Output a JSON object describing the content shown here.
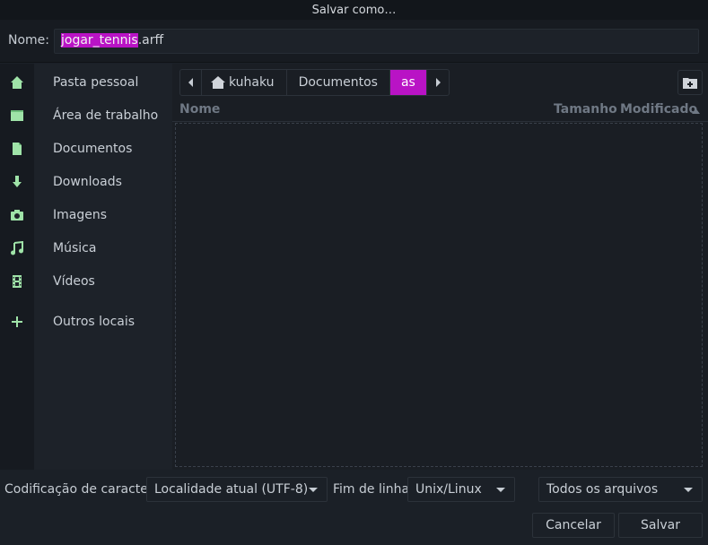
{
  "window": {
    "title": "Salvar como…"
  },
  "name_row": {
    "label": "Nome:",
    "value_selected": "jogar_tennis",
    "value_rest": ".arff"
  },
  "sidebar": {
    "items": [
      {
        "label": "Pasta pessoal",
        "icon": "home-icon"
      },
      {
        "label": "Área de trabalho",
        "icon": "desktop-icon"
      },
      {
        "label": "Documentos",
        "icon": "document-icon"
      },
      {
        "label": "Downloads",
        "icon": "download-icon"
      },
      {
        "label": "Imagens",
        "icon": "camera-icon"
      },
      {
        "label": "Música",
        "icon": "music-icon"
      },
      {
        "label": "Vídeos",
        "icon": "film-icon"
      },
      {
        "label": "Outros locais",
        "icon": "plus-icon"
      }
    ]
  },
  "pathbar": {
    "home": "kuhaku",
    "folder": "Documentos",
    "current": "as"
  },
  "columns": {
    "name": "Nome",
    "size": "Tamanho",
    "modified": "Modificado"
  },
  "bottom": {
    "encoding_label": "Codificação de caracteres:",
    "encoding_value": "Localidade atual (UTF-8)",
    "eol_label": "Fim de linha:",
    "eol_value": "Unix/Linux",
    "filter_value": "Todos os arquivos",
    "cancel": "Cancelar",
    "save": "Salvar"
  },
  "colors": {
    "accent": "#b913c5",
    "icon": "#9fe3a8",
    "background": "#1b2027"
  }
}
